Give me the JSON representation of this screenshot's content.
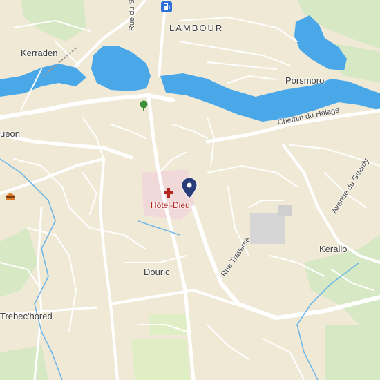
{
  "map": {
    "places": {
      "lambour": "LAMBOUR",
      "kerraden": "Kerraden",
      "porsmoro": "Porsmoro",
      "gueon": "ueon",
      "douric": "Douric",
      "keralio": "Keralio",
      "trebechored": "Trebec'hored"
    },
    "streets": {
      "rue_st": "Rue du S",
      "chemin_halage": "Chemin du Halage",
      "avenue_guerdy": "Avenue du Guerdy",
      "rue_traverse": "Rue Traverse"
    },
    "pois": {
      "hospital": "Hôtel-Dieu"
    },
    "icons": {
      "fuel": "fuel-station-icon",
      "park": "tree-icon",
      "restaurant": "burger-icon",
      "hospital": "hospital-cross-icon",
      "marker": "location-pin-icon"
    },
    "colors": {
      "land": "#efe9d6",
      "water": "#4aa8e8",
      "road": "#ffffff",
      "green": "#d6e8c4",
      "hospital_area": "#f2d9d9",
      "pin": "#2a3d7a",
      "poi_text": "#b3261e"
    }
  }
}
